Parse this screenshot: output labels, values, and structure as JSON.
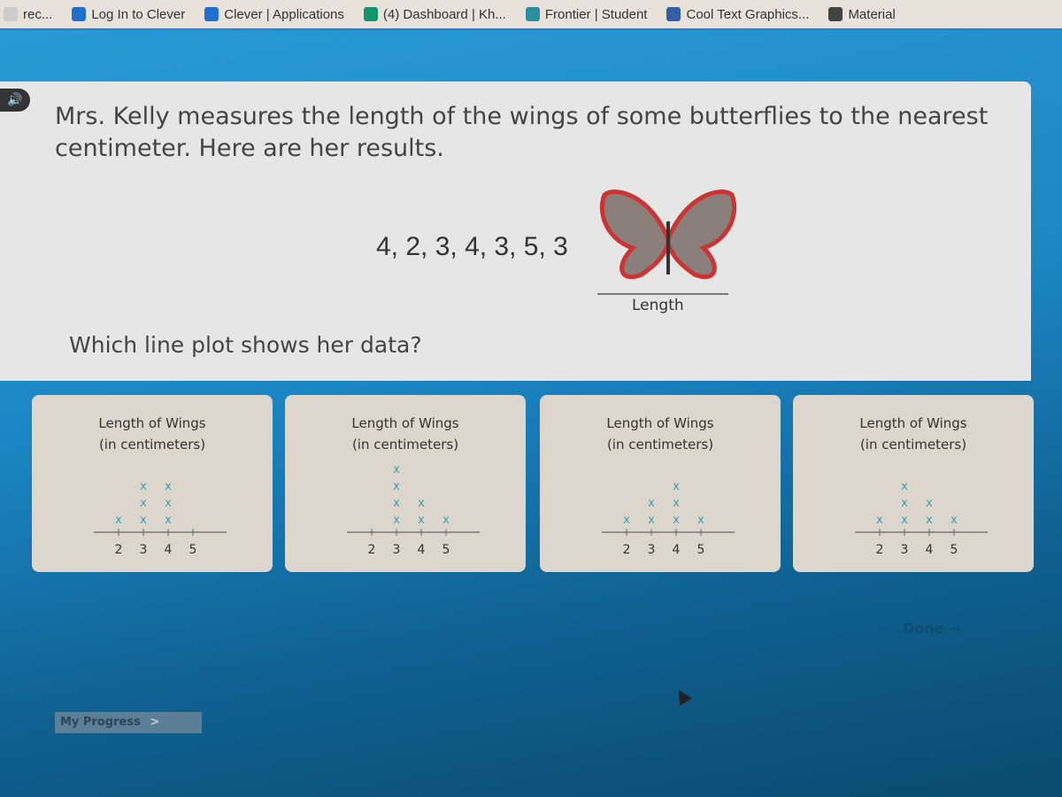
{
  "bookmarks": [
    {
      "label": "rec...",
      "icon": "bookmark-icon",
      "color": "#cccccc"
    },
    {
      "label": "Log In to Clever",
      "icon": "clever-icon",
      "color": "#1f6fd1"
    },
    {
      "label": "Clever | Applications",
      "icon": "clever-icon",
      "color": "#1f6fd1"
    },
    {
      "label": "(4) Dashboard | Kh...",
      "icon": "khan-icon",
      "color": "#14946b"
    },
    {
      "label": "Frontier | Student",
      "icon": "frontier-icon",
      "color": "#2a8fa0"
    },
    {
      "label": "Cool Text Graphics...",
      "icon": "cooltext-icon",
      "color": "#3060a0"
    },
    {
      "label": "Material",
      "icon": "grid-icon",
      "color": "#444444"
    }
  ],
  "question": {
    "prompt": "Mrs. Kelly measures the length of the wings of some butterflies to the nearest centimeter. Here are her results.",
    "data_text": "4, 2, 3, 4, 3, 5, 3",
    "image_label": "Length",
    "ask": "Which line plot shows her data?"
  },
  "chart_data": [
    {
      "type": "line-plot",
      "title": "Length of Wings",
      "subtitle": "(in centimeters)",
      "categories": [
        2,
        3,
        4,
        5
      ],
      "values": [
        1,
        3,
        3,
        0
      ],
      "mark": "x"
    },
    {
      "type": "line-plot",
      "title": "Length of Wings",
      "subtitle": "(in centimeters)",
      "categories": [
        2,
        3,
        4,
        5
      ],
      "values": [
        0,
        4,
        2,
        1
      ],
      "mark": "x"
    },
    {
      "type": "line-plot",
      "title": "Length of Wings",
      "subtitle": "(in centimeters)",
      "categories": [
        2,
        3,
        4,
        5
      ],
      "values": [
        1,
        2,
        3,
        1
      ],
      "mark": "x"
    },
    {
      "type": "line-plot",
      "title": "Length of Wings",
      "subtitle": "(in centimeters)",
      "categories": [
        2,
        3,
        4,
        5
      ],
      "values": [
        1,
        3,
        2,
        1
      ],
      "mark": "x"
    }
  ],
  "footer": {
    "progress_label": "My Progress",
    "progress_arrow": ">",
    "done_label": "Done →"
  },
  "colors": {
    "mark": "#3aa0b0",
    "background": "#1b86c4"
  }
}
